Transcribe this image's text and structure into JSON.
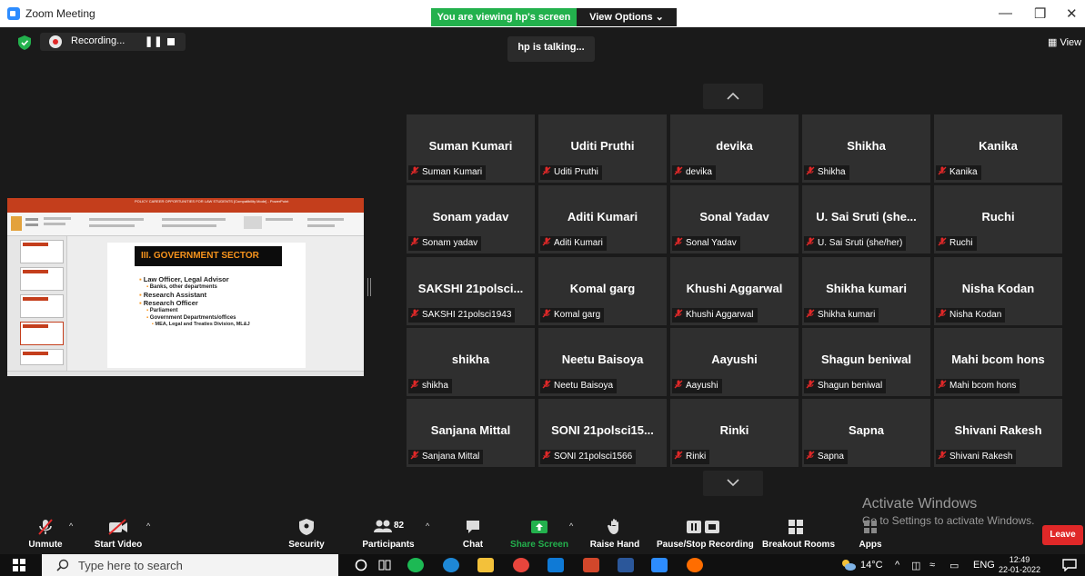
{
  "window": {
    "title": "Zoom Meeting",
    "viewing_banner": "You are viewing hp's screen",
    "view_options": "View Options",
    "minimize": "—",
    "restore": "❒",
    "close": "✕"
  },
  "top_bar": {
    "recording": "Recording...",
    "talking": "hp is talking...",
    "view": "View"
  },
  "shared_screen": {
    "app_title": "POLICY CAREER OPPORTUNITIES FOR LAW STUDENTS [Compatibility Mode] - PowerPoint",
    "slide_title": "III. GOVERNMENT SECTOR",
    "lines": [
      {
        "level": 1,
        "text": "Law Officer, Legal Advisor"
      },
      {
        "level": 2,
        "text": "Banks, other departments"
      },
      {
        "level": 1,
        "text": "Research Assistant"
      },
      {
        "level": 1,
        "text": "Research Officer"
      },
      {
        "level": 2,
        "text": "Parliament"
      },
      {
        "level": 2,
        "text": "Government Departments/offices"
      },
      {
        "level": 3,
        "text": "MEA, Legal and Treaties Division, ML&J"
      }
    ]
  },
  "participants": [
    {
      "name": "Suman Kumari",
      "label": "Suman Kumari"
    },
    {
      "name": "Uditi Pruthi",
      "label": "Uditi Pruthi"
    },
    {
      "name": "devika",
      "label": "devika"
    },
    {
      "name": "Shikha",
      "label": "Shikha"
    },
    {
      "name": "Kanika",
      "label": "Kanika"
    },
    {
      "name": "Sonam yadav",
      "label": "Sonam yadav"
    },
    {
      "name": "Aditi Kumari",
      "label": "Aditi Kumari"
    },
    {
      "name": "Sonal Yadav",
      "label": "Sonal Yadav"
    },
    {
      "name": "U. Sai Sruti (she...",
      "label": "U. Sai Sruti (she/her)"
    },
    {
      "name": "Ruchi",
      "label": "Ruchi"
    },
    {
      "name": "SAKSHI 21polsci...",
      "label": "SAKSHI 21polsci1943"
    },
    {
      "name": "Komal garg",
      "label": "Komal garg"
    },
    {
      "name": "Khushi Aggarwal",
      "label": "Khushi Aggarwal"
    },
    {
      "name": "Shikha kumari",
      "label": "Shikha kumari"
    },
    {
      "name": "Nisha Kodan",
      "label": "Nisha Kodan"
    },
    {
      "name": "shikha",
      "label": "shikha"
    },
    {
      "name": "Neetu Baisoya",
      "label": "Neetu Baisoya"
    },
    {
      "name": "Aayushi",
      "label": "Aayushi"
    },
    {
      "name": "Shagun beniwal",
      "label": "Shagun beniwal"
    },
    {
      "name": "Mahi bcom hons",
      "label": "Mahi bcom hons"
    },
    {
      "name": "Sanjana Mittal",
      "label": "Sanjana Mittal"
    },
    {
      "name": "SONI 21polsci15...",
      "label": "SONI 21polsci1566"
    },
    {
      "name": "Rinki",
      "label": "Rinki"
    },
    {
      "name": "Sapna",
      "label": "Sapna"
    },
    {
      "name": "Shivani Rakesh",
      "label": "Shivani Rakesh"
    }
  ],
  "watermark": {
    "line1": "Activate Windows",
    "line2": "Go to Settings to activate Windows."
  },
  "controls": {
    "unmute": "Unmute",
    "start_video": "Start Video",
    "security": "Security",
    "participants": "Participants",
    "participant_count": "82",
    "chat": "Chat",
    "share_screen": "Share Screen",
    "raise_hand": "Raise Hand",
    "pause_recording": "Pause/Stop Recording",
    "breakout_rooms": "Breakout Rooms",
    "apps": "Apps",
    "leave": "Leave"
  },
  "taskbar": {
    "search_placeholder": "Type here to search",
    "temperature": "14°C",
    "language": "ENG",
    "time": "12:49",
    "date": "22-01-2022"
  },
  "colors": {
    "share_green": "#23b14d",
    "leave_red": "#e02828",
    "muted_red": "#e02828",
    "tile_bg": "#2f2f2f"
  }
}
